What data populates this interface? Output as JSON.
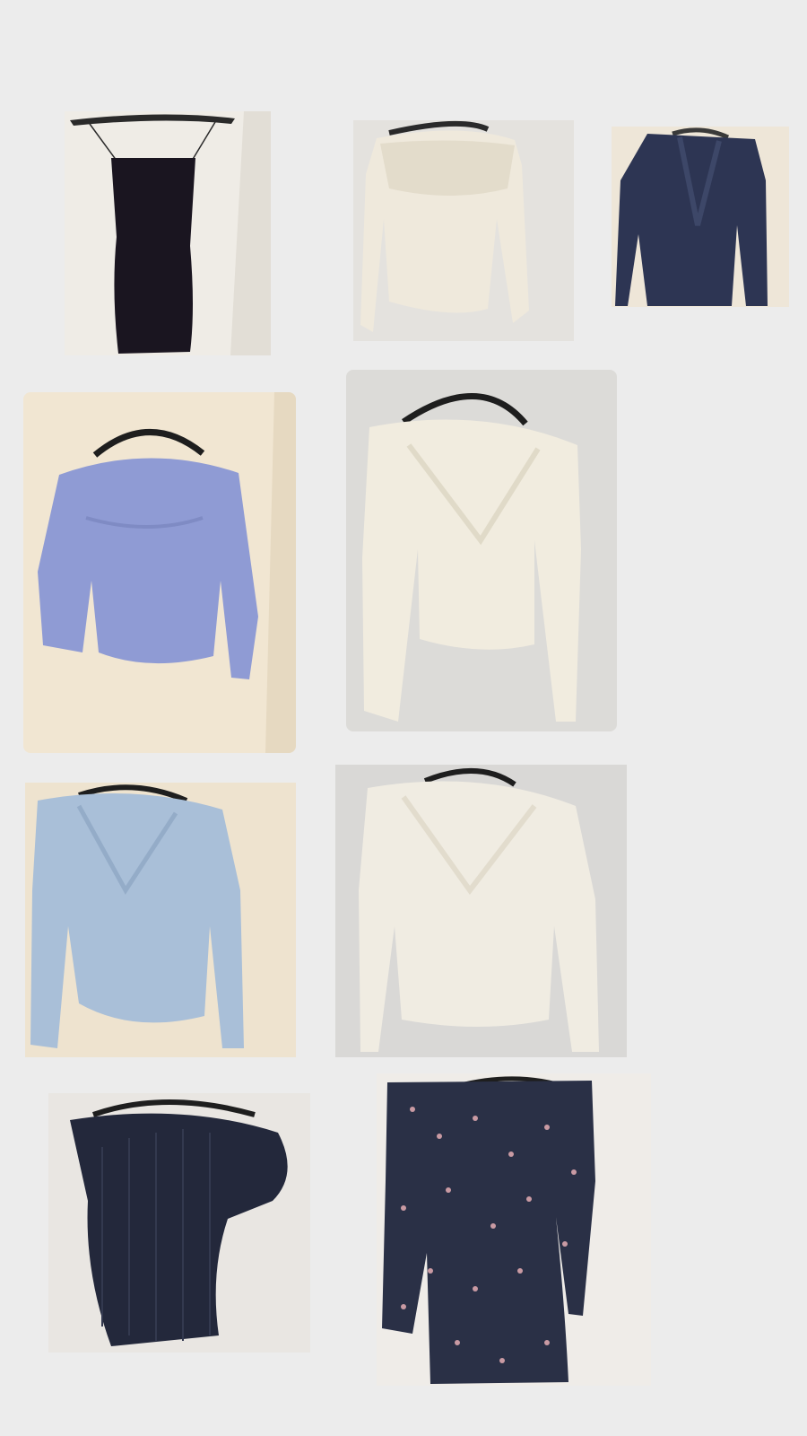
{
  "page": {
    "background": "#ececec"
  },
  "items": [
    {
      "id": "black-slip-dress",
      "colors": {
        "wall": "#efece6",
        "garment": "#1a1520",
        "hanger": "#2a2a2a"
      }
    },
    {
      "id": "cream-knit-sweater",
      "colors": {
        "wall": "#e4e2de",
        "garment": "#efe9dc",
        "hanger": "#2a2a2a"
      }
    },
    {
      "id": "navy-blazer",
      "colors": {
        "wall": "#eee6d8",
        "garment": "#2d3553",
        "hanger": "#3a3a3a"
      }
    },
    {
      "id": "lavender-knit-sweater",
      "colors": {
        "wall": "#f1e6d2",
        "garment": "#8f9bd4",
        "hanger": "#1e1e1e"
      }
    },
    {
      "id": "cream-lace-top",
      "colors": {
        "wall": "#dcdbd8",
        "garment": "#f1ecdf",
        "hanger": "#1e1e1e"
      }
    },
    {
      "id": "light-blue-blouse",
      "colors": {
        "wall": "#eee3cf",
        "garment": "#a9bfd8",
        "hanger": "#1e1e1e"
      }
    },
    {
      "id": "cream-ruffle-blouse",
      "colors": {
        "wall": "#d9d8d6",
        "garment": "#f0ece2",
        "hanger": "#1e1e1e"
      }
    },
    {
      "id": "navy-sequin-top",
      "colors": {
        "wall": "#e9e6e2",
        "garment": "#23283b",
        "hanger": "#1e1e1e"
      }
    },
    {
      "id": "floral-wrap-dress",
      "colors": {
        "wall": "#efece8",
        "garment": "#2a3046",
        "hanger": "#1e1e1e",
        "print": "#c99aa3"
      }
    }
  ]
}
